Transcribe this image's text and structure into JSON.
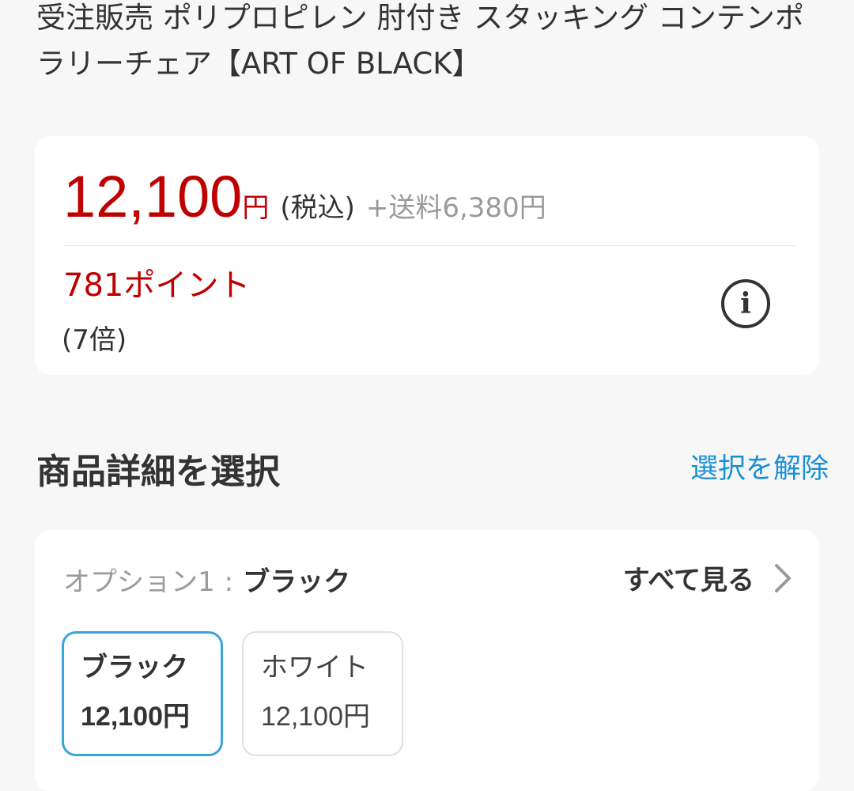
{
  "product": {
    "title": "受注販売 ポリプロピレン 肘付き スタッキング コンテンポラリーチェア【ART OF BLACK】"
  },
  "pricing": {
    "price": "12,100",
    "yen": "円",
    "tax_note": "(税込)",
    "shipping": "+送料6,380円",
    "points": "781ポイント",
    "points_multiplier": "(7倍)",
    "info_icon": "info-icon"
  },
  "options": {
    "section_title": "商品詳細を選択",
    "clear_label": "選択を解除",
    "option1_label": "オプション1",
    "separator": ":",
    "option1_selected": "ブラック",
    "see_all_label": "すべて見る",
    "choices": [
      {
        "name": "ブラック",
        "price": "12,100円"
      },
      {
        "name": "ホワイト",
        "price": "12,100円"
      }
    ]
  },
  "colors": {
    "price_red": "#bf0000",
    "link_blue": "#1a8fd6",
    "selected_border": "#3aa4dc"
  }
}
